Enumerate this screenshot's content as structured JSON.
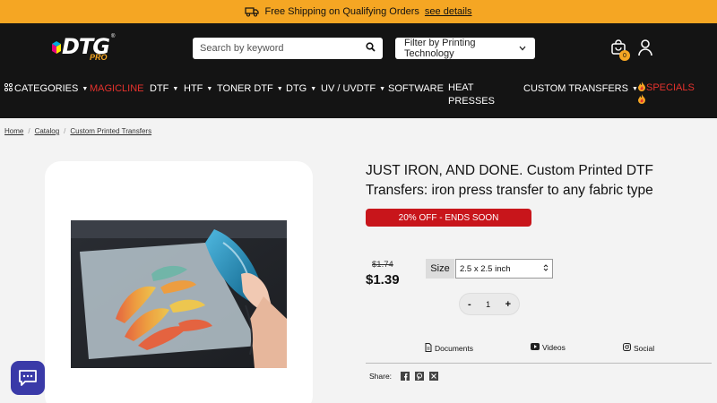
{
  "announcement": {
    "text": "Free Shipping on Qualifying Orders",
    "link": "see details"
  },
  "header": {
    "logo": {
      "main": "DTG",
      "sub": "PRO",
      "mark": "®"
    },
    "search": {
      "placeholder": "Search by keyword",
      "value": ""
    },
    "filter": {
      "label": "Filter by Printing Technology"
    },
    "cart": {
      "count": "0"
    },
    "icons": [
      "truck-icon",
      "search-icon",
      "cart-icon",
      "user-icon"
    ]
  },
  "nav": {
    "items": [
      {
        "label": "CATEGORIES",
        "dropdown": true
      },
      {
        "label": "MAGICLINE",
        "dropdown": false
      },
      {
        "label": "DTF",
        "dropdown": true
      },
      {
        "label": "HTF",
        "dropdown": true
      },
      {
        "label": "TONER DTF",
        "dropdown": true
      },
      {
        "label": "DTG",
        "dropdown": true
      },
      {
        "label": "UV / UVDTF",
        "dropdown": true
      },
      {
        "label": "SOFTWARE",
        "dropdown": false
      },
      {
        "label": "HEAT PRESSES",
        "dropdown": false
      },
      {
        "label": "CUSTOM TRANSFERS",
        "dropdown": true
      },
      {
        "label": "SPECIALS",
        "dropdown": false
      }
    ]
  },
  "breadcrumb": [
    "Home",
    "Catalog",
    "Custom Printed Transfers"
  ],
  "product": {
    "title": "JUST IRON, AND DONE. Custom Printed DTF Transfers: iron press transfer to any fabric type",
    "sale_badge": "20% OFF - ENDS SOON",
    "old_price": "$1.74",
    "price": "$1.39",
    "size_label": "Size",
    "size_value": "2.5 x 2.5 inch",
    "quantity": "1",
    "qty_minus": "-",
    "qty_plus": "+"
  },
  "tabs": [
    "Documents",
    "Videos",
    "Social"
  ],
  "share": {
    "label": "Share:"
  },
  "colors": {
    "accent": "#f5a623",
    "header_bg": "#141414",
    "sale_red": "#c8151b",
    "nav_red": "#e5322d",
    "chat": "#3a3aa8"
  }
}
